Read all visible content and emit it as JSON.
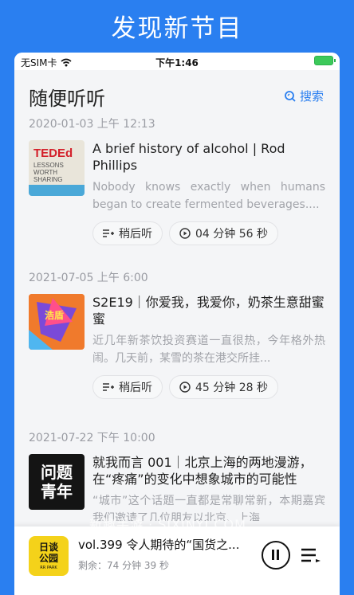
{
  "promo": {
    "title": "发现新节目"
  },
  "status_bar": {
    "carrier": "无SIM卡",
    "time": "下午1:46"
  },
  "header": {
    "title": "随便听听",
    "search_label": "搜索"
  },
  "episodes": [
    {
      "date": "2020-01-03 上午 12:13",
      "title": "A brief history of alcohol | Rod Phillips",
      "description": "Nobody knows exactly when humans began to create fermented beverages....",
      "later_label": "稍后听",
      "duration": "04 分钟 56 秒",
      "cover": {
        "brand": "TEDEd",
        "lines": [
          "LESSONS",
          "WORTH",
          "SHARING"
        ]
      }
    },
    {
      "date": "2021-07-05 上午 6:00",
      "title": "S2E19｜你爱我，我爱你，奶茶生意甜蜜蜜",
      "description": "近几年新茶饮投资赛道一直很热，今年格外热闹。几天前，某雪的茶在港交所挂...",
      "later_label": "稍后听",
      "duration": "45 分钟 28 秒",
      "cover": {
        "brand": "浩盾"
      }
    },
    {
      "date": "2021-07-22 下午 10:00",
      "title": "就我而言 001｜北京上海的两地漫游，在“疼痛”的变化中想象城市的可能性",
      "description": "“城市”这个话题一直都是常聊常新，本期嘉宾我们邀请了几位朋友以北京、上海",
      "cover": {
        "lines": [
          "问题",
          "青年"
        ]
      }
    }
  ],
  "player": {
    "title": "vol.399 令人期待的“国货之...",
    "remaining": "剩余：74 分钟 39 秒",
    "cover": {
      "lines": [
        "日谈",
        "公园"
      ],
      "tag": "RR PARK"
    }
  },
  "watermark": "新趣手游 · SJXINYI.COM",
  "colors": {
    "accent": "#2a7ff0",
    "background": "#f4f5f7"
  }
}
